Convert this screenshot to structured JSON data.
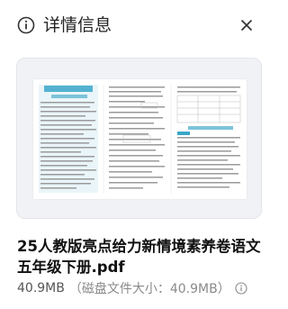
{
  "header": {
    "title": "详情信息",
    "info_icon": "info-circle-icon",
    "close_icon": "close-icon"
  },
  "preview": {
    "doc_heading": "第一单元综合素质提升卷",
    "doc_subheading": "第二章 学习内容"
  },
  "file": {
    "name": "25人教版亮点给力新情境素养卷语文 五年级下册.pdf",
    "size": "40.9MB",
    "disk_size": "（磁盘文件大小：40.9MB）",
    "help_icon": "info-circle-icon"
  },
  "colors": {
    "icon": "#333333",
    "preview_bg": "#f1f2f5",
    "doc_accent": "#3aa6c9"
  }
}
